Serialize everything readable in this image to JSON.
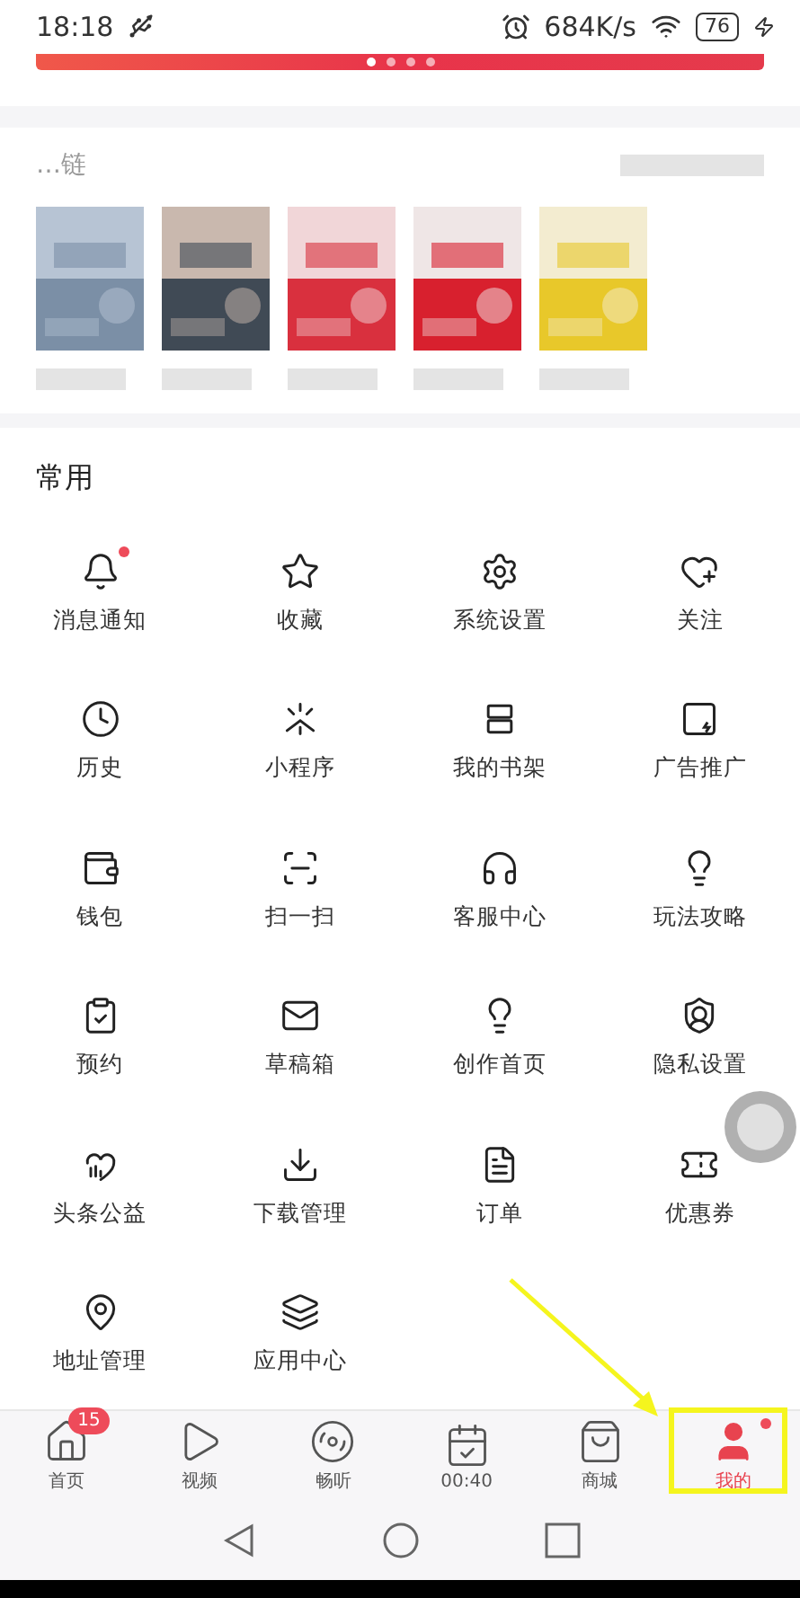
{
  "status_bar": {
    "time": "18:18",
    "speed": "684K/s",
    "battery": "76"
  },
  "banner": {
    "dots": [
      {
        "selected": true
      },
      {
        "selected": false
      },
      {
        "selected": false
      },
      {
        "selected": false
      }
    ]
  },
  "recent_section": {
    "title": "…链"
  },
  "common_section": {
    "title": "常用",
    "items": [
      {
        "label": "消息通知",
        "dot": true
      },
      {
        "label": "收藏",
        "dot": false
      },
      {
        "label": "系统设置",
        "dot": false
      },
      {
        "label": "关注",
        "dot": false
      },
      {
        "label": "历史",
        "dot": false
      },
      {
        "label": "小程序",
        "dot": false
      },
      {
        "label": "我的书架",
        "dot": false
      },
      {
        "label": "广告推广",
        "dot": false
      },
      {
        "label": "钱包",
        "dot": false
      },
      {
        "label": "扫一扫",
        "dot": false
      },
      {
        "label": "客服中心",
        "dot": false
      },
      {
        "label": "玩法攻略",
        "dot": false
      },
      {
        "label": "预约",
        "dot": false
      },
      {
        "label": "草稿箱",
        "dot": false
      },
      {
        "label": "创作首页",
        "dot": false
      },
      {
        "label": "隐私设置",
        "dot": false
      },
      {
        "label": "头条公益",
        "dot": false
      },
      {
        "label": "下载管理",
        "dot": false
      },
      {
        "label": "订单",
        "dot": false
      },
      {
        "label": "优惠券",
        "dot": false
      },
      {
        "label": "地址管理",
        "dot": false
      },
      {
        "label": "应用中心",
        "dot": false
      }
    ]
  },
  "tab_bar": [
    {
      "label": "首页",
      "selected": false,
      "badge": "15",
      "dot": false
    },
    {
      "label": "视频",
      "selected": false,
      "dot": false
    },
    {
      "label": "畅听",
      "selected": false,
      "dot": false
    },
    {
      "label": "00:40",
      "selected": false,
      "dot": false
    },
    {
      "label": "商城",
      "selected": false,
      "dot": false
    },
    {
      "label": "我的",
      "selected": true,
      "dot": true
    }
  ]
}
